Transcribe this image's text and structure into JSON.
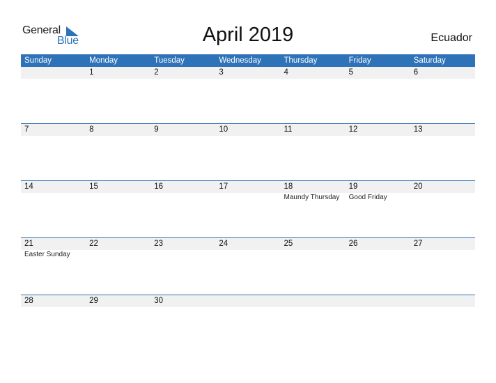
{
  "logo": {
    "general": "General",
    "blue": "Blue"
  },
  "title": "April 2019",
  "country": "Ecuador",
  "colors": {
    "accent": "#2e72b8",
    "row_bg": "#f1f1f1"
  },
  "weekdays": [
    "Sunday",
    "Monday",
    "Tuesday",
    "Wednesday",
    "Thursday",
    "Friday",
    "Saturday"
  ],
  "weeks": [
    {
      "days": [
        "",
        "1",
        "2",
        "3",
        "4",
        "5",
        "6"
      ],
      "events": [
        "",
        "",
        "",
        "",
        "",
        "",
        ""
      ]
    },
    {
      "days": [
        "7",
        "8",
        "9",
        "10",
        "11",
        "12",
        "13"
      ],
      "events": [
        "",
        "",
        "",
        "",
        "",
        "",
        ""
      ]
    },
    {
      "days": [
        "14",
        "15",
        "16",
        "17",
        "18",
        "19",
        "20"
      ],
      "events": [
        "",
        "",
        "",
        "",
        "Maundy Thursday",
        "Good Friday",
        ""
      ]
    },
    {
      "days": [
        "21",
        "22",
        "23",
        "24",
        "25",
        "26",
        "27"
      ],
      "events": [
        "Easter Sunday",
        "",
        "",
        "",
        "",
        "",
        ""
      ]
    },
    {
      "days": [
        "28",
        "29",
        "30",
        "",
        "",
        "",
        ""
      ],
      "events": [
        "",
        "",
        "",
        "",
        "",
        "",
        ""
      ]
    }
  ]
}
